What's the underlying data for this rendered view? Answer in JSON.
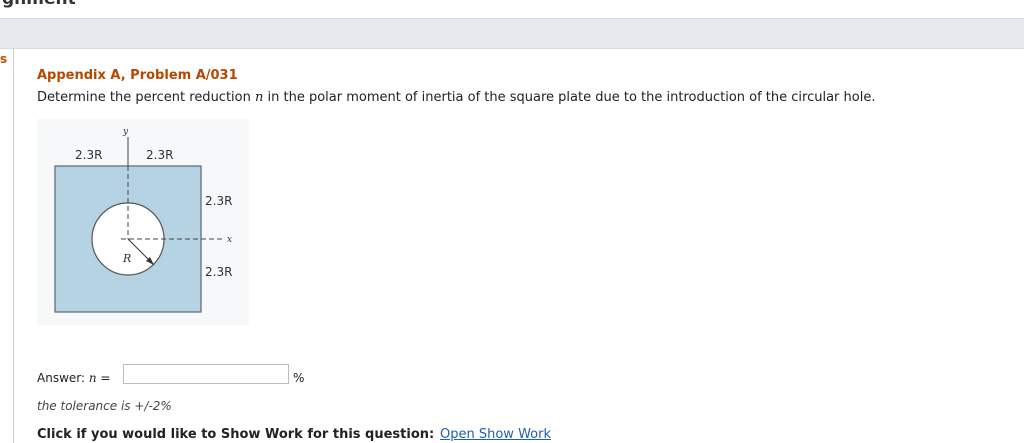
{
  "header": {
    "cut_title": "gnment"
  },
  "side_marker": "s",
  "problem": {
    "title": "Appendix A, Problem A/031",
    "question_before": "Determine the percent reduction ",
    "question_var": "n",
    "question_after": " in the polar moment of inertia of the square plate due to the introduction of the circular hole."
  },
  "figure": {
    "label_top_left": "2.3R",
    "label_top_right": "2.3R",
    "label_right_upper": "2.3R",
    "label_right_lower": "2.3R",
    "label_radius": "R",
    "axis_y": "y",
    "axis_x": "x",
    "plate_color": "#b6d3e4",
    "hole_color": "#ffffff"
  },
  "answer": {
    "label_prefix": "Answer: ",
    "label_var": "n",
    "label_suffix": " =",
    "value": "",
    "unit": "%"
  },
  "tolerance": "the tolerance is +/-2%",
  "show_work": {
    "label": "Click if you would like to Show Work for this question:",
    "link": "Open Show Work"
  }
}
